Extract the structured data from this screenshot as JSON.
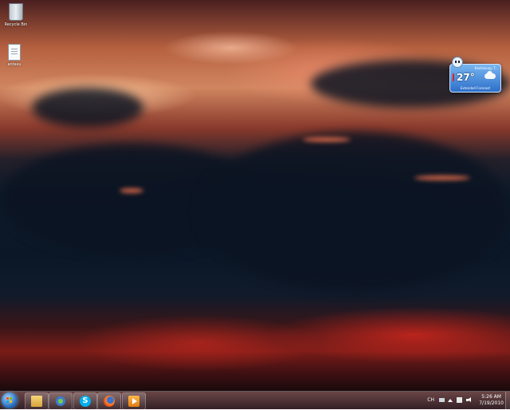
{
  "desktop": {
    "icons": [
      {
        "name": "recycle-bin",
        "label": "Recycle Bin"
      },
      {
        "name": "text-file",
        "label": "antasu"
      }
    ]
  },
  "weather": {
    "city": "Kaohsiung, T...",
    "temperature": "27°",
    "forecast_link": "Extended Forecast"
  },
  "taskbar": {
    "pinned": [
      "explorer-icon",
      "network-icon",
      "skype-icon",
      "firefox-icon",
      "media-player-icon"
    ],
    "skype_glyph": "S",
    "tray": {
      "language": "CH",
      "time": "5:26 AM",
      "date": "7/19/2010"
    }
  },
  "colors": {
    "taskbar": "#3a1c22",
    "weather_gadget": "#2d6fca"
  }
}
